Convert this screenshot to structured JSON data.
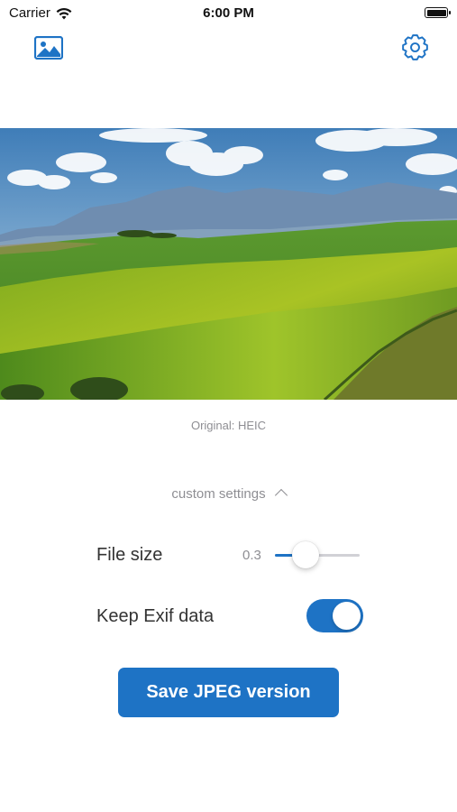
{
  "status_bar": {
    "carrier": "Carrier",
    "time": "6:00 PM",
    "wifi_icon": "wifi-icon",
    "battery_icon": "battery-icon"
  },
  "toolbar": {
    "photo_icon": "photo-library-icon",
    "settings_icon": "gear-icon"
  },
  "preview": {
    "format_label": "Original: HEIC"
  },
  "settings": {
    "toggle_label": "custom settings",
    "toggle_icon": "chevron-up-icon",
    "file_size_label": "File size",
    "file_size_value": "0.3",
    "file_size_fraction": 0.36,
    "keep_exif_label": "Keep Exif data",
    "keep_exif_on": true
  },
  "actions": {
    "save_label": "Save JPEG version"
  },
  "colors": {
    "accent": "#1e73c5",
    "secondary_text": "#8e8e93"
  }
}
